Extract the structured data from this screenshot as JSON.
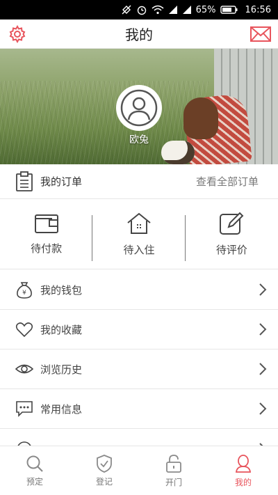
{
  "status_bar": {
    "battery": "65%",
    "time": "16:56"
  },
  "header": {
    "title": "我的"
  },
  "profile": {
    "username": "欧兔"
  },
  "orders": {
    "title": "我的订单",
    "view_all": "查看全部订单",
    "statuses": [
      "待付款",
      "待入住",
      "待评价"
    ]
  },
  "menu": {
    "items": [
      {
        "label": "我的钱包",
        "icon": "wallet-bag-icon"
      },
      {
        "label": "我的收藏",
        "icon": "heart-icon"
      },
      {
        "label": "浏览历史",
        "icon": "eye-icon"
      },
      {
        "label": "常用信息",
        "icon": "message-icon"
      }
    ]
  },
  "bottom_nav": {
    "items": [
      {
        "label": "预定",
        "icon": "search-icon"
      },
      {
        "label": "登记",
        "icon": "shield-check-icon"
      },
      {
        "label": "开门",
        "icon": "lock-icon"
      },
      {
        "label": "我的",
        "icon": "person-icon"
      }
    ],
    "active_color": "#e8545c",
    "inactive_color": "#8a8a8a"
  },
  "colors": {
    "accent": "#e8545c"
  }
}
